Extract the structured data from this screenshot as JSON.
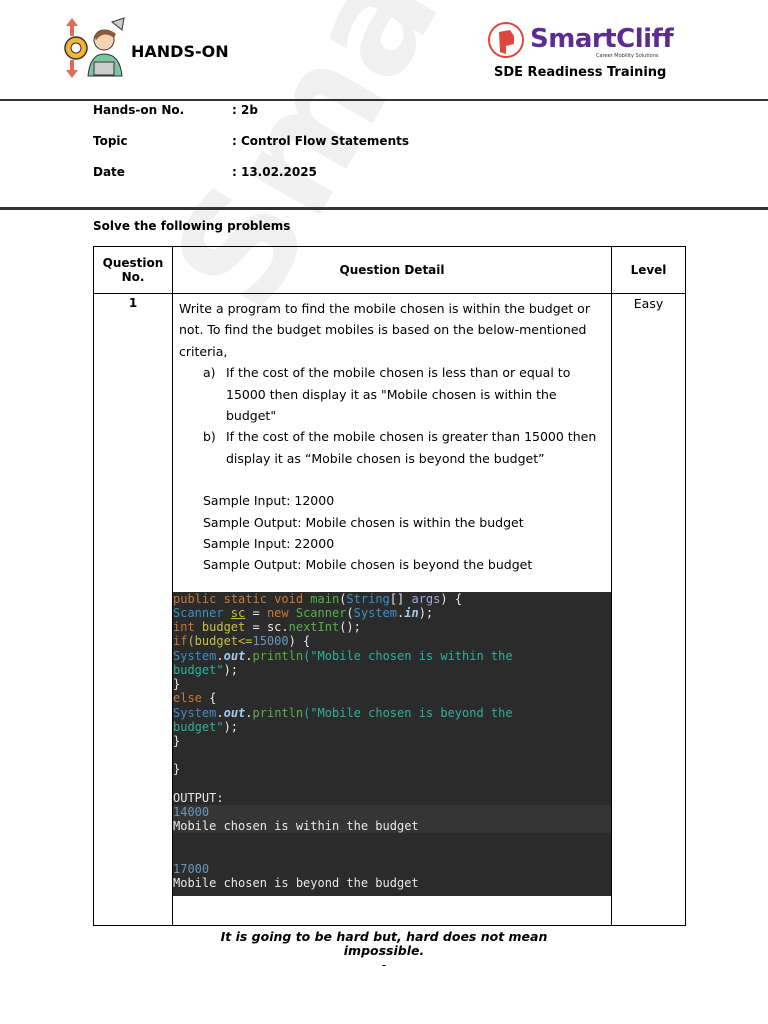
{
  "header": {
    "title": "HANDS-ON",
    "brand": "SmartCliff",
    "brand_tagline": "Career Mobility Solutions",
    "program": "SDE Readiness Training"
  },
  "meta": [
    {
      "label": "Hands-on No.",
      "value": ": 2b"
    },
    {
      "label": "Topic",
      "value": ": Control Flow Statements"
    },
    {
      "label": "Date",
      "value": ": 13.02.2025"
    }
  ],
  "instruction": "Solve the following problems",
  "table": {
    "headers": [
      "Question No.",
      "Question Detail",
      "Level"
    ],
    "rows": [
      {
        "no": "1",
        "level": "Easy",
        "intro": "Write a program to find the mobile chosen is within the budget or not. To find the budget mobiles is based on the below-mentioned criteria,",
        "criteria": [
          {
            "marker": "a)",
            "text": "If the cost of the mobile chosen is less than or equal to 15000 then display it as \"Mobile chosen is within the budget\""
          },
          {
            "marker": "b)",
            "text": "If the cost of the mobile chosen is greater than 15000 then display it as “Mobile chosen is beyond the budget”"
          }
        ],
        "samples": [
          "Sample Input: 12000",
          "Sample Output: Mobile chosen is within the budget",
          "Sample Input: 22000",
          "Sample Output: Mobile chosen is beyond the budget"
        ],
        "code": [
          [
            [
              "public static void ",
              "kw"
            ],
            [
              "main",
              "fn"
            ],
            [
              "(",
              "pl"
            ],
            [
              "String",
              "ty"
            ],
            [
              "[] ",
              "pl"
            ],
            [
              "args",
              "ar"
            ],
            [
              ") {",
              "pl"
            ]
          ],
          [
            [
              "Scanner ",
              "ty"
            ],
            [
              "sc",
              "ul"
            ],
            [
              " = ",
              "pl"
            ],
            [
              "new ",
              "kw"
            ],
            [
              "Scanner",
              "fn"
            ],
            [
              "(",
              "pl"
            ],
            [
              "System",
              "ty"
            ],
            [
              ".",
              "pl"
            ],
            [
              "in",
              "it"
            ],
            [
              ");",
              "pl"
            ]
          ],
          [
            [
              "int ",
              "kw"
            ],
            [
              "budget",
              "va"
            ],
            [
              " = sc.",
              "pl"
            ],
            [
              "nextInt",
              "fn"
            ],
            [
              "();",
              "pl"
            ]
          ],
          [
            [
              "if",
              "kw"
            ],
            [
              "(budget<=",
              "va"
            ],
            [
              "15000",
              "nu"
            ],
            [
              ") {",
              "pl"
            ]
          ],
          [
            [
              "System",
              "ty"
            ],
            [
              ".",
              "pl"
            ],
            [
              "out",
              "it"
            ],
            [
              ".",
              "pl"
            ],
            [
              "println",
              "fn"
            ],
            [
              "(\"Mobile chosen is within the",
              "st"
            ]
          ],
          [
            [
              "budget\"",
              "st"
            ],
            [
              ");",
              "pl"
            ]
          ],
          [
            [
              "}",
              "pl"
            ]
          ],
          [
            [
              "else ",
              "kw"
            ],
            [
              "{",
              "pl"
            ]
          ],
          [
            [
              "System",
              "ty"
            ],
            [
              ".",
              "pl"
            ],
            [
              "out",
              "it"
            ],
            [
              ".",
              "pl"
            ],
            [
              "println",
              "fn"
            ],
            [
              "(\"Mobile chosen is beyond the",
              "st"
            ]
          ],
          [
            [
              "budget\"",
              "st"
            ],
            [
              ");",
              "pl"
            ]
          ],
          [
            [
              "}",
              "pl"
            ]
          ],
          [],
          [
            [
              "}",
              "pl"
            ]
          ],
          [],
          [
            [
              "OUTPUT:",
              "pl"
            ]
          ],
          [
            [
              "14000",
              "nu"
            ]
          ],
          [
            [
              "Mobile chosen is within the budget",
              "pl"
            ]
          ],
          [],
          [],
          [
            [
              "17000",
              "nu"
            ]
          ],
          [
            [
              "Mobile chosen is beyond the budget",
              "pl"
            ]
          ]
        ]
      }
    ]
  },
  "footer": {
    "quote": "It is going to be hard but, hard does not mean impossible.",
    "mark": "-"
  }
}
